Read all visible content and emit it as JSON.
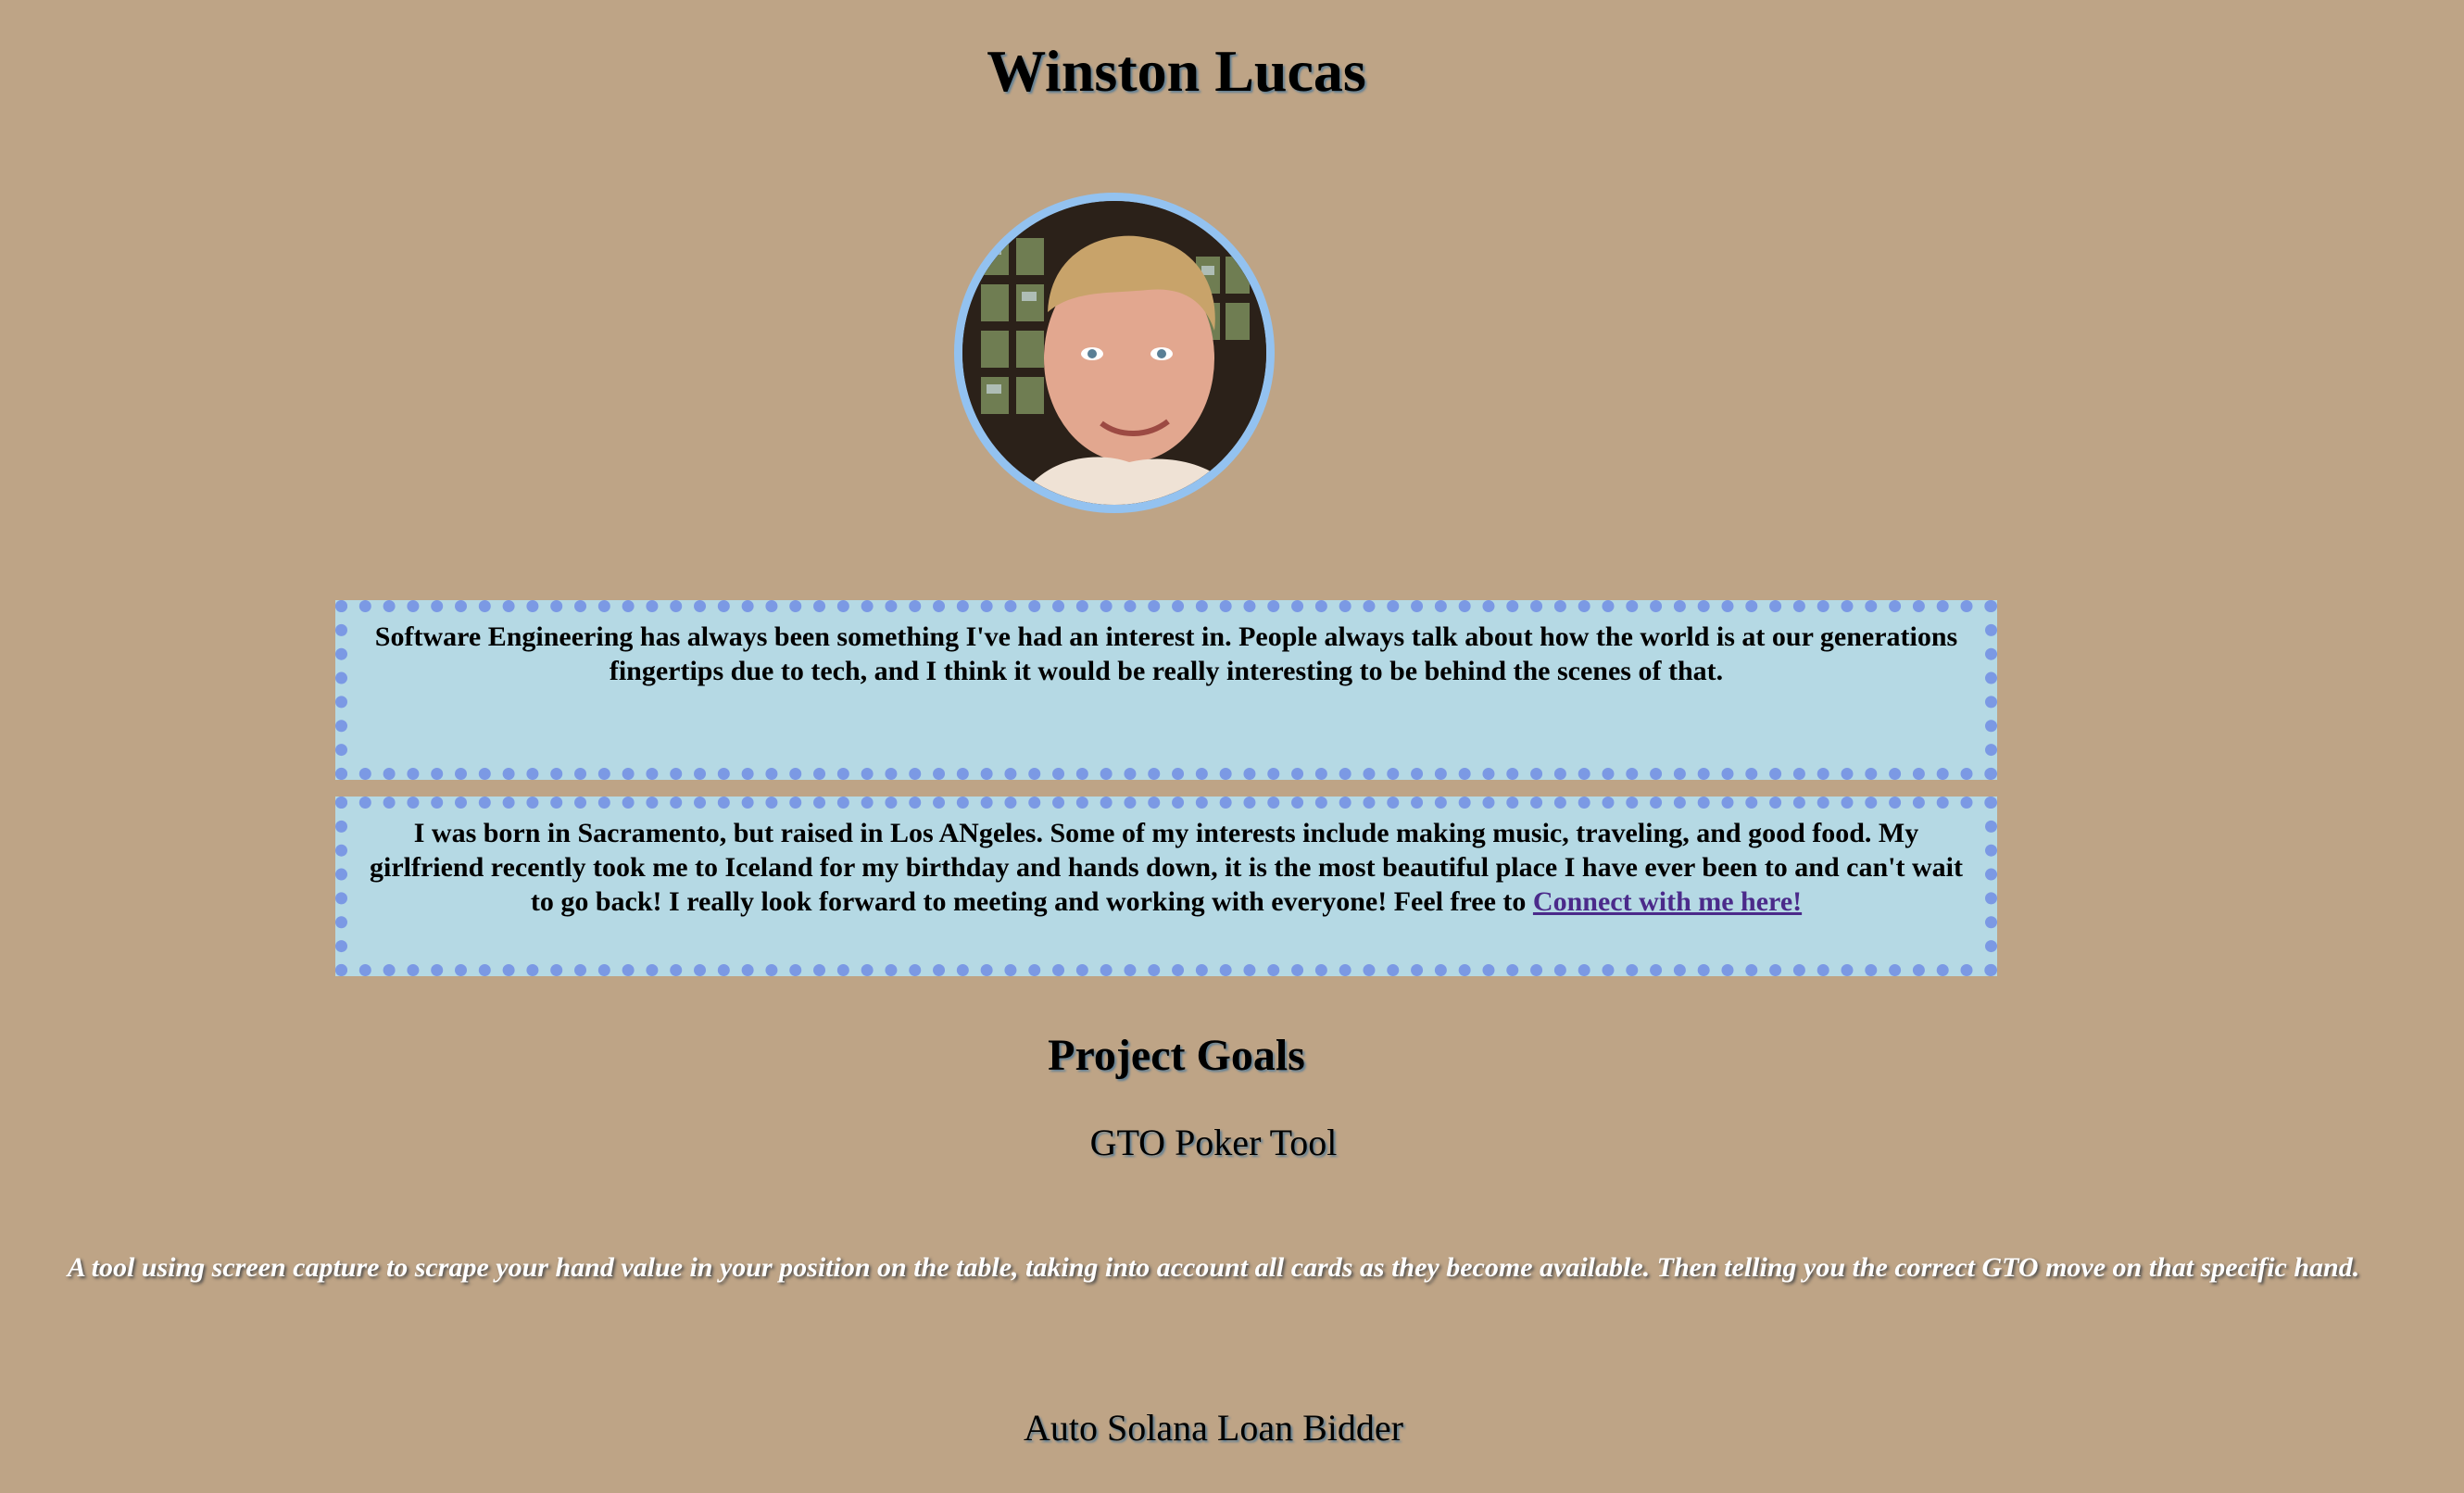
{
  "header": {
    "name": "Winston Lucas"
  },
  "profile": {
    "photo_icon": "profile-photo"
  },
  "bio": {
    "paragraph1": "Software Engineering has always been something I've had an interest in. People always talk about how the world is at our generations fingertips due to tech, and I think it would be really interesting to be behind the scenes of that.",
    "paragraph2_text": "I was born in Sacramento, but raised in Los ANgeles. Some of my interests include making music, traveling, and good food. My girlfriend recently took me to Iceland for my birthday and hands down, it is the most beautiful place I have ever been to and can't wait to go back! I really look forward to meeting and working with everyone! Feel free to ",
    "link_label": "Connect with me here!"
  },
  "projects": {
    "heading": "Project Goals",
    "items": [
      {
        "title": "GTO Poker Tool",
        "description": "A tool using screen capture to scrape your hand value in your position on the table, taking into account all cards as they become available. Then telling you the correct GTO move on that specific hand."
      },
      {
        "title": "Auto Solana Loan Bidder"
      }
    ]
  },
  "colors": {
    "background": "#bea486",
    "box_background": "#b5d9e4",
    "box_border": "#7b99e4",
    "avatar_border": "#93c2f0",
    "link": "#4b2a8a"
  }
}
